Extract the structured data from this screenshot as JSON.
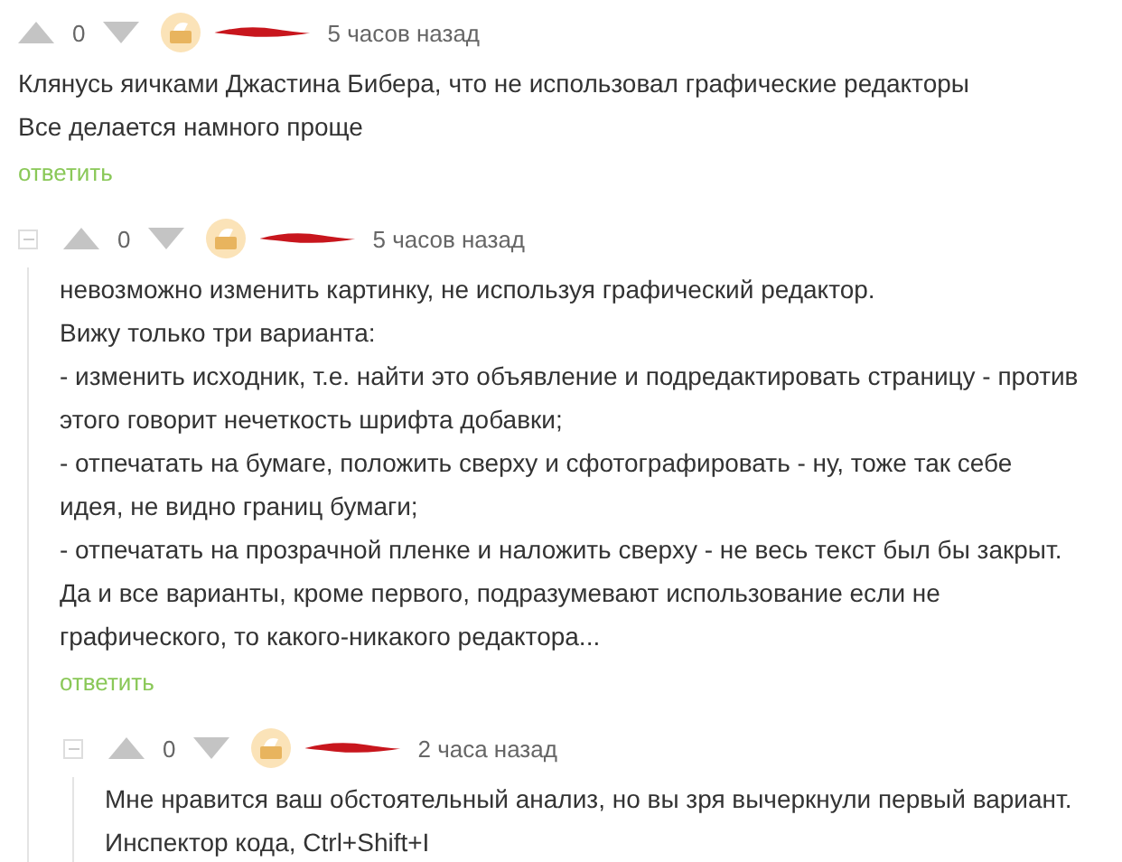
{
  "comments": [
    {
      "collapsible": false,
      "rating": "0",
      "time": "5 часов назад",
      "lines": [
        "Клянусь яичками Джастина Бибера, что не использовал графические редакторы",
        "Все делается намного проще"
      ],
      "reply": "ответить",
      "children": [
        {
          "collapsible": true,
          "rating": "0",
          "time": "5 часов назад",
          "lines": [
            "невозможно изменить картинку, не используя графический редактор.",
            "Вижу только три варианта:",
            "- изменить исходник, т.е. найти это объявление и подредактировать страницу - против этого говорит нечеткость шрифта добавки;",
            "- отпечатать на бумаге, положить сверху и сфотографировать - ну, тоже так себе идея, не видно границ бумаги;",
            "- отпечатать на прозрачной пленке и наложить сверху - не весь текст был бы закрыт.",
            "Да и все варианты, кроме первого, подразумевают использование если не графического, то какого-никакого редактора..."
          ],
          "reply": "ответить",
          "children": [
            {
              "collapsible": true,
              "rating": "0",
              "time": "2 часа назад",
              "lines": [
                "Мне нравится ваш обстоятельный анализ, но вы зря вычеркнули первый вариант.",
                "Инспектор кода, Ctrl+Shift+I"
              ]
            }
          ]
        }
      ]
    }
  ]
}
